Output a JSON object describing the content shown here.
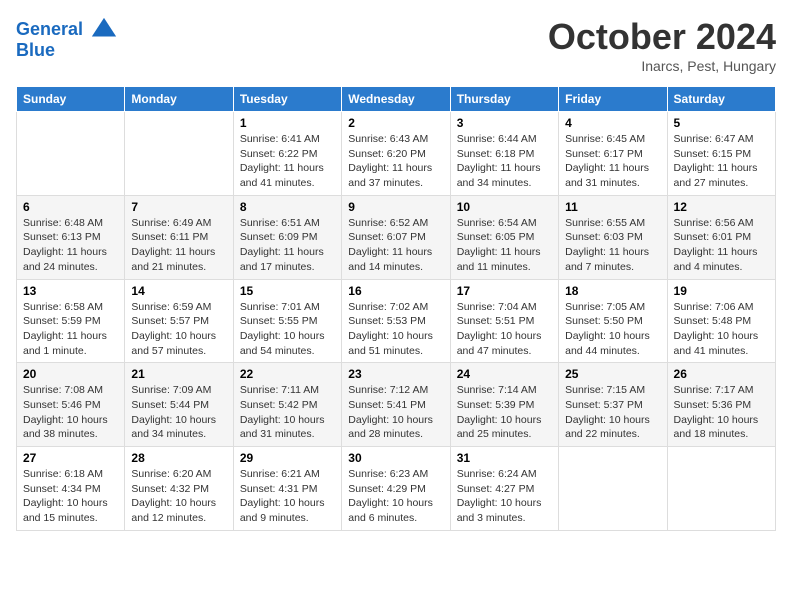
{
  "header": {
    "logo_line1": "General",
    "logo_line2": "Blue",
    "month_title": "October 2024",
    "location": "Inarcs, Pest, Hungary"
  },
  "days_of_week": [
    "Sunday",
    "Monday",
    "Tuesday",
    "Wednesday",
    "Thursday",
    "Friday",
    "Saturday"
  ],
  "weeks": [
    [
      {
        "day": "",
        "info": ""
      },
      {
        "day": "",
        "info": ""
      },
      {
        "day": "1",
        "info": "Sunrise: 6:41 AM\nSunset: 6:22 PM\nDaylight: 11 hours and 41 minutes."
      },
      {
        "day": "2",
        "info": "Sunrise: 6:43 AM\nSunset: 6:20 PM\nDaylight: 11 hours and 37 minutes."
      },
      {
        "day": "3",
        "info": "Sunrise: 6:44 AM\nSunset: 6:18 PM\nDaylight: 11 hours and 34 minutes."
      },
      {
        "day": "4",
        "info": "Sunrise: 6:45 AM\nSunset: 6:17 PM\nDaylight: 11 hours and 31 minutes."
      },
      {
        "day": "5",
        "info": "Sunrise: 6:47 AM\nSunset: 6:15 PM\nDaylight: 11 hours and 27 minutes."
      }
    ],
    [
      {
        "day": "6",
        "info": "Sunrise: 6:48 AM\nSunset: 6:13 PM\nDaylight: 11 hours and 24 minutes."
      },
      {
        "day": "7",
        "info": "Sunrise: 6:49 AM\nSunset: 6:11 PM\nDaylight: 11 hours and 21 minutes."
      },
      {
        "day": "8",
        "info": "Sunrise: 6:51 AM\nSunset: 6:09 PM\nDaylight: 11 hours and 17 minutes."
      },
      {
        "day": "9",
        "info": "Sunrise: 6:52 AM\nSunset: 6:07 PM\nDaylight: 11 hours and 14 minutes."
      },
      {
        "day": "10",
        "info": "Sunrise: 6:54 AM\nSunset: 6:05 PM\nDaylight: 11 hours and 11 minutes."
      },
      {
        "day": "11",
        "info": "Sunrise: 6:55 AM\nSunset: 6:03 PM\nDaylight: 11 hours and 7 minutes."
      },
      {
        "day": "12",
        "info": "Sunrise: 6:56 AM\nSunset: 6:01 PM\nDaylight: 11 hours and 4 minutes."
      }
    ],
    [
      {
        "day": "13",
        "info": "Sunrise: 6:58 AM\nSunset: 5:59 PM\nDaylight: 11 hours and 1 minute."
      },
      {
        "day": "14",
        "info": "Sunrise: 6:59 AM\nSunset: 5:57 PM\nDaylight: 10 hours and 57 minutes."
      },
      {
        "day": "15",
        "info": "Sunrise: 7:01 AM\nSunset: 5:55 PM\nDaylight: 10 hours and 54 minutes."
      },
      {
        "day": "16",
        "info": "Sunrise: 7:02 AM\nSunset: 5:53 PM\nDaylight: 10 hours and 51 minutes."
      },
      {
        "day": "17",
        "info": "Sunrise: 7:04 AM\nSunset: 5:51 PM\nDaylight: 10 hours and 47 minutes."
      },
      {
        "day": "18",
        "info": "Sunrise: 7:05 AM\nSunset: 5:50 PM\nDaylight: 10 hours and 44 minutes."
      },
      {
        "day": "19",
        "info": "Sunrise: 7:06 AM\nSunset: 5:48 PM\nDaylight: 10 hours and 41 minutes."
      }
    ],
    [
      {
        "day": "20",
        "info": "Sunrise: 7:08 AM\nSunset: 5:46 PM\nDaylight: 10 hours and 38 minutes."
      },
      {
        "day": "21",
        "info": "Sunrise: 7:09 AM\nSunset: 5:44 PM\nDaylight: 10 hours and 34 minutes."
      },
      {
        "day": "22",
        "info": "Sunrise: 7:11 AM\nSunset: 5:42 PM\nDaylight: 10 hours and 31 minutes."
      },
      {
        "day": "23",
        "info": "Sunrise: 7:12 AM\nSunset: 5:41 PM\nDaylight: 10 hours and 28 minutes."
      },
      {
        "day": "24",
        "info": "Sunrise: 7:14 AM\nSunset: 5:39 PM\nDaylight: 10 hours and 25 minutes."
      },
      {
        "day": "25",
        "info": "Sunrise: 7:15 AM\nSunset: 5:37 PM\nDaylight: 10 hours and 22 minutes."
      },
      {
        "day": "26",
        "info": "Sunrise: 7:17 AM\nSunset: 5:36 PM\nDaylight: 10 hours and 18 minutes."
      }
    ],
    [
      {
        "day": "27",
        "info": "Sunrise: 6:18 AM\nSunset: 4:34 PM\nDaylight: 10 hours and 15 minutes."
      },
      {
        "day": "28",
        "info": "Sunrise: 6:20 AM\nSunset: 4:32 PM\nDaylight: 10 hours and 12 minutes."
      },
      {
        "day": "29",
        "info": "Sunrise: 6:21 AM\nSunset: 4:31 PM\nDaylight: 10 hours and 9 minutes."
      },
      {
        "day": "30",
        "info": "Sunrise: 6:23 AM\nSunset: 4:29 PM\nDaylight: 10 hours and 6 minutes."
      },
      {
        "day": "31",
        "info": "Sunrise: 6:24 AM\nSunset: 4:27 PM\nDaylight: 10 hours and 3 minutes."
      },
      {
        "day": "",
        "info": ""
      },
      {
        "day": "",
        "info": ""
      }
    ]
  ]
}
